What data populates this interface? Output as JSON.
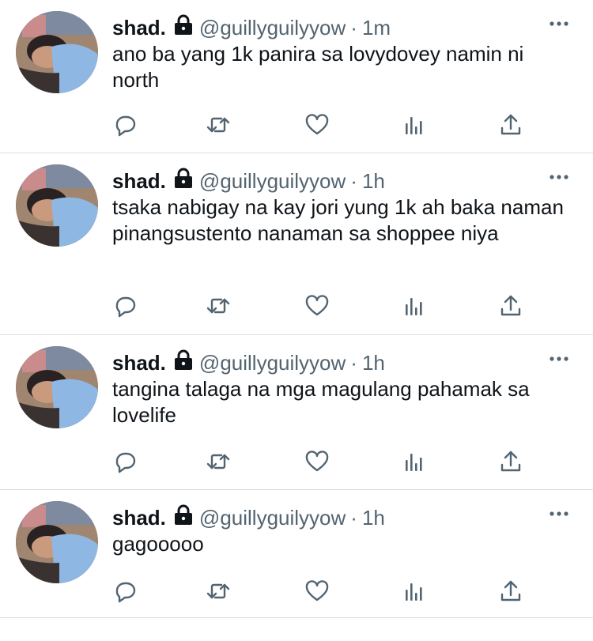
{
  "tweets": [
    {
      "name": "shad.",
      "handle": "@guillyguilyyow",
      "separator": "·",
      "time": "1m",
      "text": "ano ba yang 1k panira sa lovydovey namin ni north"
    },
    {
      "name": "shad.",
      "handle": "@guillyguilyyow",
      "separator": "·",
      "time": "1h",
      "text": "tsaka nabigay na kay jori yung 1k ah baka naman pinangsustento nanaman sa shoppee niya"
    },
    {
      "name": "shad.",
      "handle": "@guillyguilyyow",
      "separator": "·",
      "time": "1h",
      "text": "tangina talaga na mga magulang pahamak sa lovelife"
    },
    {
      "name": "shad.",
      "handle": "@guillyguilyyow",
      "separator": "·",
      "time": "1h",
      "text": "gagooooo"
    }
  ],
  "icons": {
    "lock": "lock-icon",
    "more": "more-icon",
    "reply": "reply-icon",
    "retweet": "retweet-icon",
    "like": "heart-icon",
    "analytics": "analytics-icon",
    "share": "share-icon"
  },
  "colors": {
    "text": "#0f1419",
    "secondary": "#536471",
    "divider": "#dbdde0",
    "icon": "#536471"
  }
}
